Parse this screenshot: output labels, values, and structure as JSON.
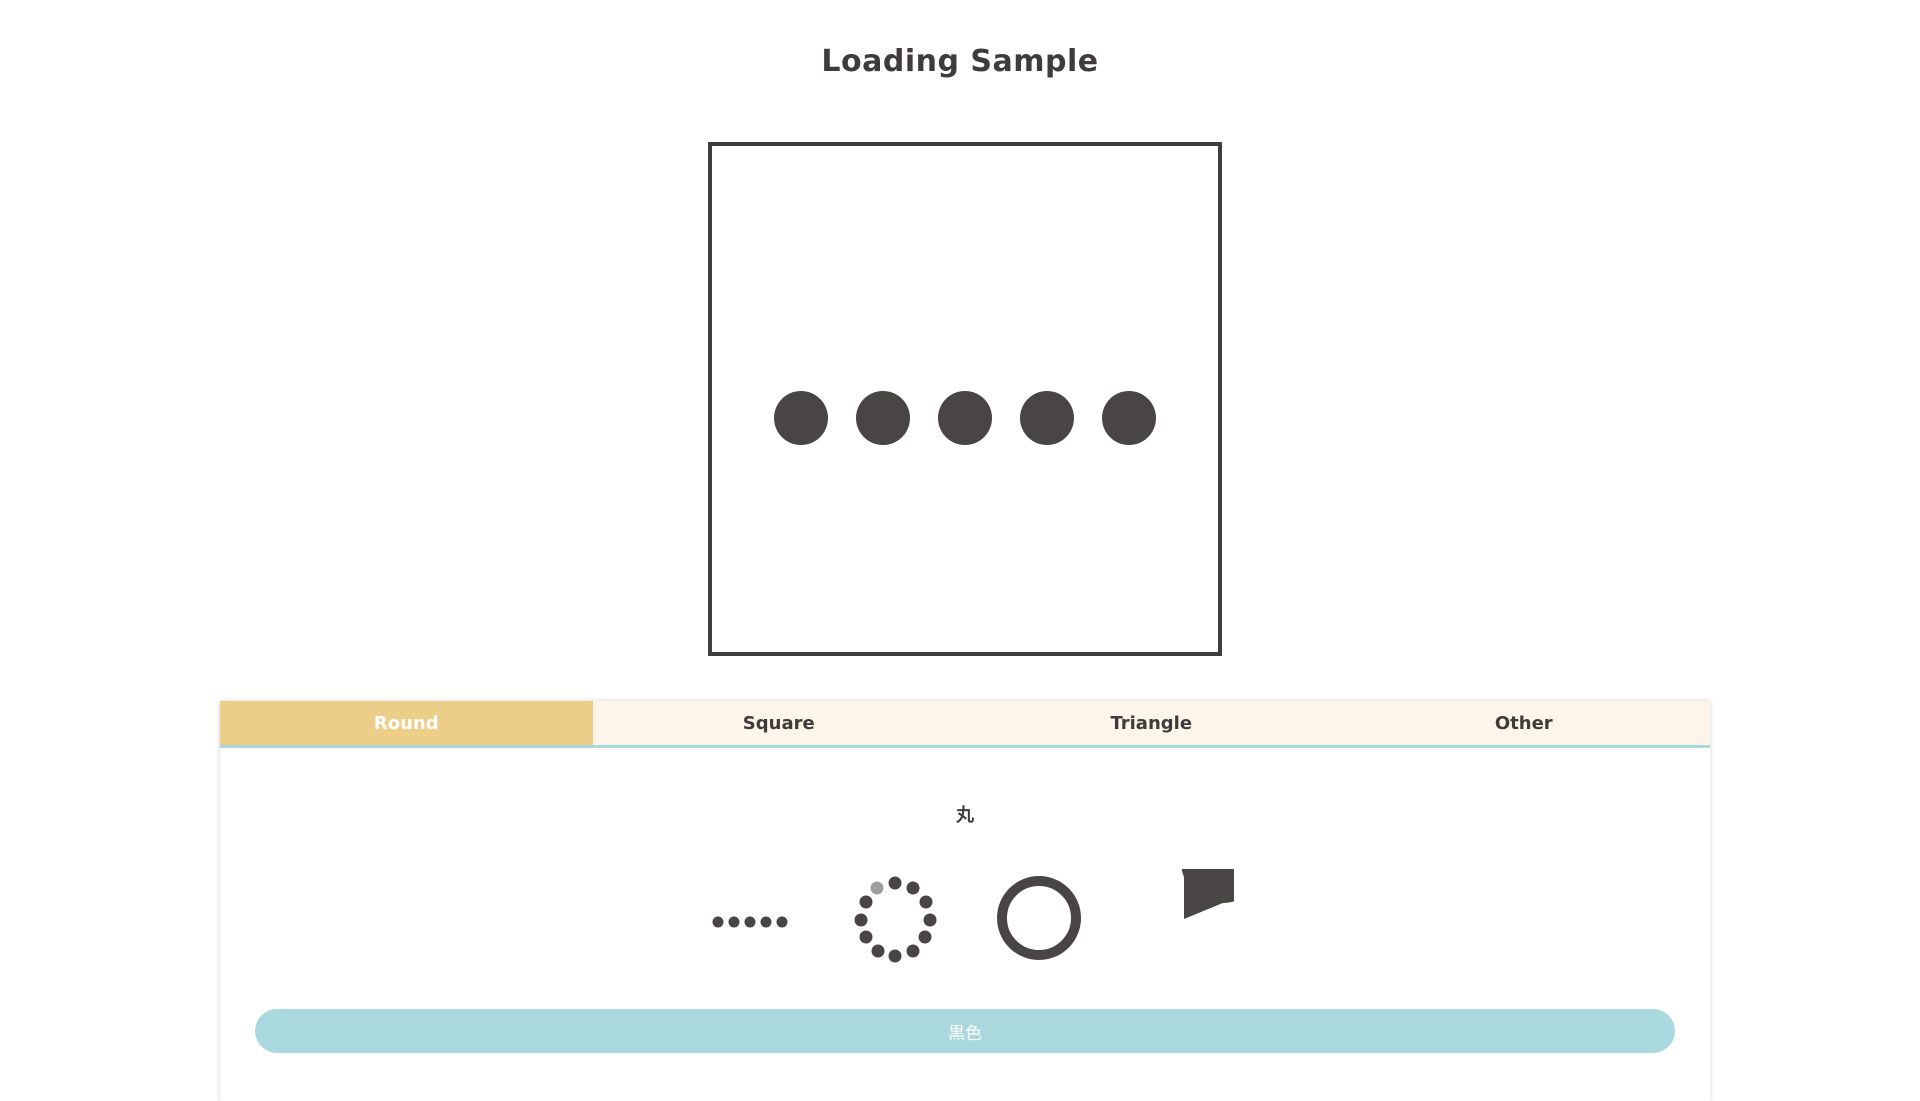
{
  "page": {
    "title": "Loading Sample"
  },
  "tabs": [
    {
      "label": "Round",
      "active": true
    },
    {
      "label": "Square",
      "active": false
    },
    {
      "label": "Triangle",
      "active": false
    },
    {
      "label": "Other",
      "active": false
    }
  ],
  "panel": {
    "section_label": "丸",
    "loader_icons": [
      "dots-row-icon",
      "dot-ring-spinner-icon",
      "ring-icon",
      "pie-icon"
    ],
    "color_button_label": "黒色"
  },
  "colors": {
    "dark": "#4a4545",
    "accent_tab": "#ecce88",
    "tab_bg": "#fdf5ea",
    "button": "#aad8df",
    "dot_highlight": "#9e9e9e"
  }
}
